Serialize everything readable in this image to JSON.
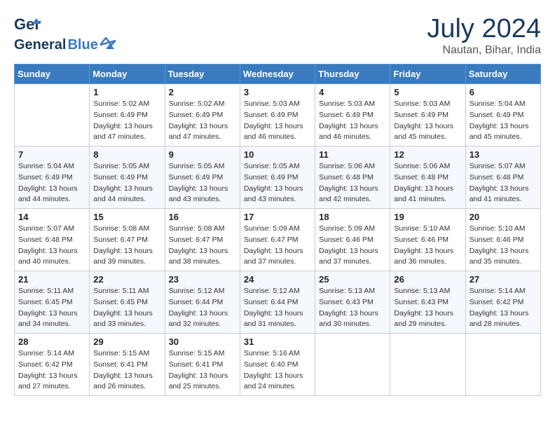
{
  "header": {
    "logo_general": "General",
    "logo_blue": "Blue",
    "month": "July 2024",
    "location": "Nautan, Bihar, India"
  },
  "days_of_week": [
    "Sunday",
    "Monday",
    "Tuesday",
    "Wednesday",
    "Thursday",
    "Friday",
    "Saturday"
  ],
  "weeks": [
    [
      {
        "day": "",
        "sunrise": "",
        "sunset": "",
        "daylight": ""
      },
      {
        "day": "1",
        "sunrise": "Sunrise: 5:02 AM",
        "sunset": "Sunset: 6:49 PM",
        "daylight": "Daylight: 13 hours and 47 minutes."
      },
      {
        "day": "2",
        "sunrise": "Sunrise: 5:02 AM",
        "sunset": "Sunset: 6:49 PM",
        "daylight": "Daylight: 13 hours and 47 minutes."
      },
      {
        "day": "3",
        "sunrise": "Sunrise: 5:03 AM",
        "sunset": "Sunset: 6:49 PM",
        "daylight": "Daylight: 13 hours and 46 minutes."
      },
      {
        "day": "4",
        "sunrise": "Sunrise: 5:03 AM",
        "sunset": "Sunset: 6:49 PM",
        "daylight": "Daylight: 13 hours and 46 minutes."
      },
      {
        "day": "5",
        "sunrise": "Sunrise: 5:03 AM",
        "sunset": "Sunset: 6:49 PM",
        "daylight": "Daylight: 13 hours and 45 minutes."
      },
      {
        "day": "6",
        "sunrise": "Sunrise: 5:04 AM",
        "sunset": "Sunset: 6:49 PM",
        "daylight": "Daylight: 13 hours and 45 minutes."
      }
    ],
    [
      {
        "day": "7",
        "sunrise": "Sunrise: 5:04 AM",
        "sunset": "Sunset: 6:49 PM",
        "daylight": "Daylight: 13 hours and 44 minutes."
      },
      {
        "day": "8",
        "sunrise": "Sunrise: 5:05 AM",
        "sunset": "Sunset: 6:49 PM",
        "daylight": "Daylight: 13 hours and 44 minutes."
      },
      {
        "day": "9",
        "sunrise": "Sunrise: 5:05 AM",
        "sunset": "Sunset: 6:49 PM",
        "daylight": "Daylight: 13 hours and 43 minutes."
      },
      {
        "day": "10",
        "sunrise": "Sunrise: 5:05 AM",
        "sunset": "Sunset: 6:49 PM",
        "daylight": "Daylight: 13 hours and 43 minutes."
      },
      {
        "day": "11",
        "sunrise": "Sunrise: 5:06 AM",
        "sunset": "Sunset: 6:48 PM",
        "daylight": "Daylight: 13 hours and 42 minutes."
      },
      {
        "day": "12",
        "sunrise": "Sunrise: 5:06 AM",
        "sunset": "Sunset: 6:48 PM",
        "daylight": "Daylight: 13 hours and 41 minutes."
      },
      {
        "day": "13",
        "sunrise": "Sunrise: 5:07 AM",
        "sunset": "Sunset: 6:48 PM",
        "daylight": "Daylight: 13 hours and 41 minutes."
      }
    ],
    [
      {
        "day": "14",
        "sunrise": "Sunrise: 5:07 AM",
        "sunset": "Sunset: 6:48 PM",
        "daylight": "Daylight: 13 hours and 40 minutes."
      },
      {
        "day": "15",
        "sunrise": "Sunrise: 5:08 AM",
        "sunset": "Sunset: 6:47 PM",
        "daylight": "Daylight: 13 hours and 39 minutes."
      },
      {
        "day": "16",
        "sunrise": "Sunrise: 5:08 AM",
        "sunset": "Sunset: 6:47 PM",
        "daylight": "Daylight: 13 hours and 38 minutes."
      },
      {
        "day": "17",
        "sunrise": "Sunrise: 5:09 AM",
        "sunset": "Sunset: 6:47 PM",
        "daylight": "Daylight: 13 hours and 37 minutes."
      },
      {
        "day": "18",
        "sunrise": "Sunrise: 5:09 AM",
        "sunset": "Sunset: 6:46 PM",
        "daylight": "Daylight: 13 hours and 37 minutes."
      },
      {
        "day": "19",
        "sunrise": "Sunrise: 5:10 AM",
        "sunset": "Sunset: 6:46 PM",
        "daylight": "Daylight: 13 hours and 36 minutes."
      },
      {
        "day": "20",
        "sunrise": "Sunrise: 5:10 AM",
        "sunset": "Sunset: 6:46 PM",
        "daylight": "Daylight: 13 hours and 35 minutes."
      }
    ],
    [
      {
        "day": "21",
        "sunrise": "Sunrise: 5:11 AM",
        "sunset": "Sunset: 6:45 PM",
        "daylight": "Daylight: 13 hours and 34 minutes."
      },
      {
        "day": "22",
        "sunrise": "Sunrise: 5:11 AM",
        "sunset": "Sunset: 6:45 PM",
        "daylight": "Daylight: 13 hours and 33 minutes."
      },
      {
        "day": "23",
        "sunrise": "Sunrise: 5:12 AM",
        "sunset": "Sunset: 6:44 PM",
        "daylight": "Daylight: 13 hours and 32 minutes."
      },
      {
        "day": "24",
        "sunrise": "Sunrise: 5:12 AM",
        "sunset": "Sunset: 6:44 PM",
        "daylight": "Daylight: 13 hours and 31 minutes."
      },
      {
        "day": "25",
        "sunrise": "Sunrise: 5:13 AM",
        "sunset": "Sunset: 6:43 PM",
        "daylight": "Daylight: 13 hours and 30 minutes."
      },
      {
        "day": "26",
        "sunrise": "Sunrise: 5:13 AM",
        "sunset": "Sunset: 6:43 PM",
        "daylight": "Daylight: 13 hours and 29 minutes."
      },
      {
        "day": "27",
        "sunrise": "Sunrise: 5:14 AM",
        "sunset": "Sunset: 6:42 PM",
        "daylight": "Daylight: 13 hours and 28 minutes."
      }
    ],
    [
      {
        "day": "28",
        "sunrise": "Sunrise: 5:14 AM",
        "sunset": "Sunset: 6:42 PM",
        "daylight": "Daylight: 13 hours and 27 minutes."
      },
      {
        "day": "29",
        "sunrise": "Sunrise: 5:15 AM",
        "sunset": "Sunset: 6:41 PM",
        "daylight": "Daylight: 13 hours and 26 minutes."
      },
      {
        "day": "30",
        "sunrise": "Sunrise: 5:15 AM",
        "sunset": "Sunset: 6:41 PM",
        "daylight": "Daylight: 13 hours and 25 minutes."
      },
      {
        "day": "31",
        "sunrise": "Sunrise: 5:16 AM",
        "sunset": "Sunset: 6:40 PM",
        "daylight": "Daylight: 13 hours and 24 minutes."
      },
      {
        "day": "",
        "sunrise": "",
        "sunset": "",
        "daylight": ""
      },
      {
        "day": "",
        "sunrise": "",
        "sunset": "",
        "daylight": ""
      },
      {
        "day": "",
        "sunrise": "",
        "sunset": "",
        "daylight": ""
      }
    ]
  ]
}
